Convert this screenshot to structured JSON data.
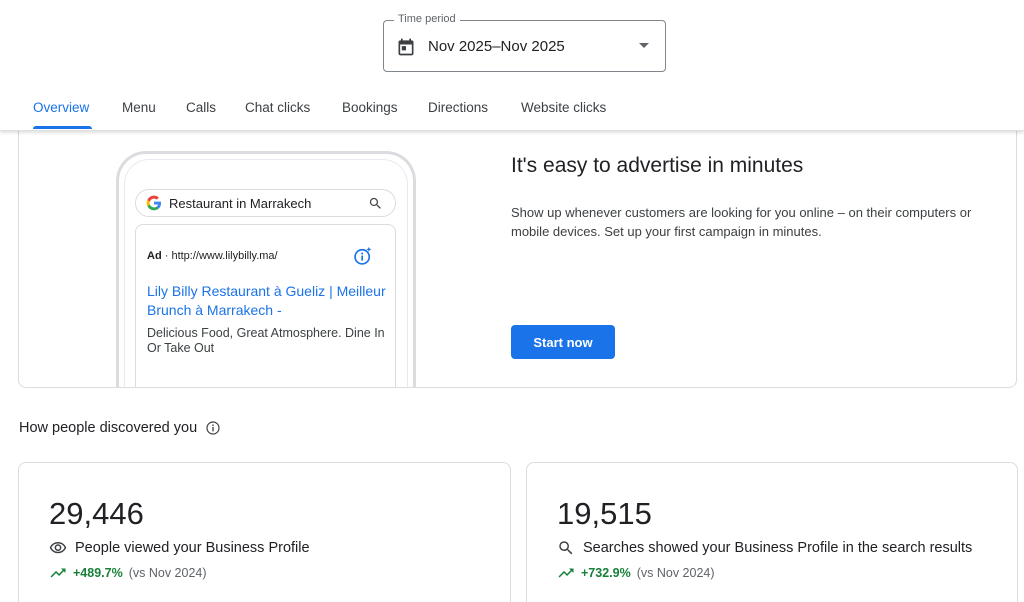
{
  "time_period": {
    "legend": "Time period",
    "value": "Nov 2025–Nov 2025"
  },
  "tabs": [
    {
      "label": "Overview",
      "active": true
    },
    {
      "label": "Menu"
    },
    {
      "label": "Calls"
    },
    {
      "label": "Chat clicks"
    },
    {
      "label": "Bookings"
    },
    {
      "label": "Directions"
    },
    {
      "label": "Website clicks"
    }
  ],
  "ad_preview": {
    "search_query": "Restaurant in Marrakech",
    "ad_badge": "Ad",
    "ad_url": " · http://www.lilybilly.ma/",
    "result_title": "Lily Billy Restaurant à Gueliz | Meilleur Brunch à Marrakech -",
    "result_description": "Delicious Food, Great Atmosphere. Dine In Or Take Out"
  },
  "advertise": {
    "title": "It's easy to advertise in minutes",
    "description": "Show up whenever customers are looking for you online – on their computers or mobile devices. Set up your first campaign in minutes.",
    "button_label": "Start now"
  },
  "discovery": {
    "heading": "How people discovered you",
    "cards": [
      {
        "value": "29,446",
        "label": "People viewed your Business Profile",
        "change": "+489.7%",
        "comparison": "(vs Nov 2024)"
      },
      {
        "value": "19,515",
        "label": "Searches showed your Business Profile in the search results",
        "change": "+732.9%",
        "comparison": "(vs Nov 2024)"
      }
    ]
  },
  "colors": {
    "accent": "#1a73e8",
    "positive": "#188038"
  }
}
